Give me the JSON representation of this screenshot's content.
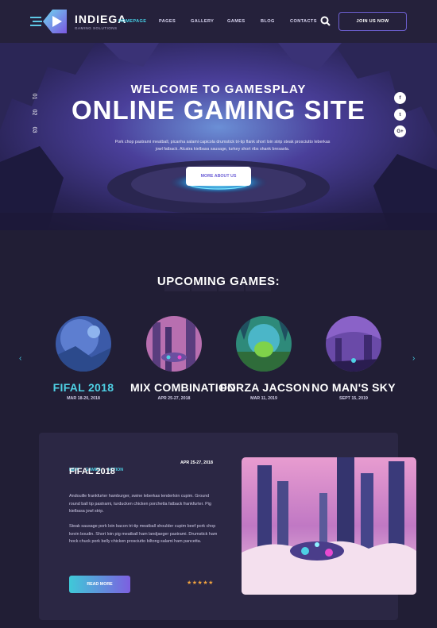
{
  "brand": {
    "name": "INDIEGA",
    "tagline": "GAMING SOLUTIONS"
  },
  "nav": {
    "items": [
      "HOMEPAGE",
      "PAGES",
      "GALLERY",
      "GAMES",
      "BLOG",
      "CONTACTS"
    ],
    "active": "HOMEPAGE",
    "cta": "JOIN US NOW",
    "search_icon": "search-icon"
  },
  "hero": {
    "welcome": "WELCOME TO GAMESPLAY",
    "title": "ONLINE GAMING SITE",
    "text": "Pork chop pastrami meatball, picanha salami capicola drumstick tri-tip flank short loin strip steak prosciutto leberkas jowl fatback. Alcatra kielbasa sausage, turkey short ribs shank bresaola.",
    "button": "MORE ABOUT US",
    "slides": [
      "01",
      "02",
      "03"
    ],
    "social": [
      "f",
      "t",
      "G+"
    ]
  },
  "upcoming": {
    "title": "UPCOMING GAMES:",
    "games": [
      {
        "name": "FIFAL 2018",
        "date": "MAR 18-20, 2018"
      },
      {
        "name": "MIX COMBINATION",
        "date": "APR 25-27, 2018"
      },
      {
        "name": "FORZA JACSON",
        "date": "MAR 11, 2019"
      },
      {
        "name": "NO MAN'S SKY",
        "date": "SEPT 15, 2019"
      }
    ],
    "prev": "‹",
    "next": "›"
  },
  "featured": {
    "tags": [
      "NEW",
      "GAMES",
      "ACTION"
    ],
    "date": "APR 25-27, 2018",
    "title": "FIFAL 2018",
    "para1": "Andouille frankfurter hamburger, swine leberkas tenderloin cupim. Ground round ball tip pastrami, turducken chicken porchetta fatback frankfurter. Pig kielbasa jowl strip.",
    "para2": "Steak sausage pork loin bacon tri-tip meatball shoulder cupim beef pork chop kevin boudin. Short loin pig meatball ham landjaeger pastrami. Drumstick ham hock chuck pork belly chicken prosciutto biltong salami ham pancetta.",
    "button": "READ MORE",
    "rating": 5,
    "stars": "★★★★★"
  },
  "colors": {
    "accent": "#46d0e6",
    "purple": "#6d5fd0",
    "bg": "#211e35",
    "card": "#2b2744",
    "star": "#f3a43f"
  }
}
